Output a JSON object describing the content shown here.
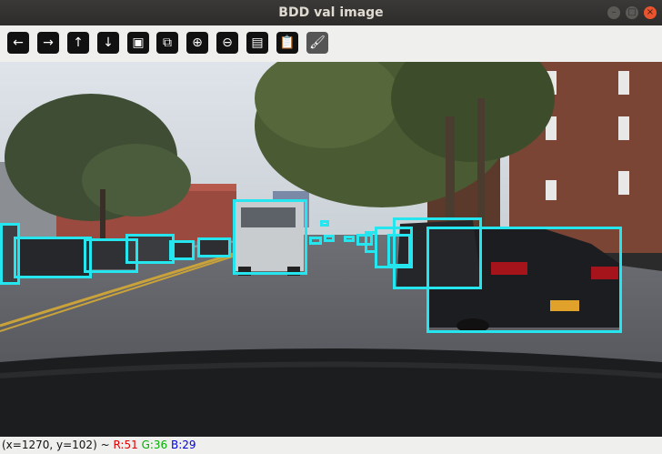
{
  "window": {
    "title": "BDD val image"
  },
  "window_controls": [
    "minimize",
    "maximize",
    "close"
  ],
  "toolbar": {
    "buttons": [
      {
        "name": "pan-left-button",
        "icon": "arrow-left-icon",
        "glyph": "←"
      },
      {
        "name": "pan-right-button",
        "icon": "arrow-right-icon",
        "glyph": "→"
      },
      {
        "name": "pan-up-button",
        "icon": "arrow-up-icon",
        "glyph": "↑"
      },
      {
        "name": "pan-down-button",
        "icon": "arrow-down-icon",
        "glyph": "↓"
      },
      {
        "name": "zoom-reset-button",
        "icon": "image-icon",
        "glyph": "▣"
      },
      {
        "name": "zoom-fit-button",
        "icon": "image-search-icon",
        "glyph": "⧉"
      },
      {
        "name": "zoom-in-button",
        "icon": "zoom-in-icon",
        "glyph": "⊕"
      },
      {
        "name": "zoom-out-button",
        "icon": "zoom-out-icon",
        "glyph": "⊖"
      },
      {
        "name": "save-button",
        "icon": "save-icon",
        "glyph": "▤"
      },
      {
        "name": "copy-button",
        "icon": "clipboard-icon",
        "glyph": "📋"
      },
      {
        "name": "properties-button",
        "icon": "brush-icon",
        "glyph": "🖌"
      }
    ]
  },
  "image": {
    "description_icon": "street-scene-image",
    "box_color": "#25e6ee",
    "detections_count": 17
  },
  "status": {
    "coords": "(x=1270, y=102) ~",
    "r": "R:51",
    "g": "G:36",
    "b": "B:29",
    "r_color": "#e00000",
    "g_color": "#00b000",
    "b_color": "#0000e0"
  }
}
